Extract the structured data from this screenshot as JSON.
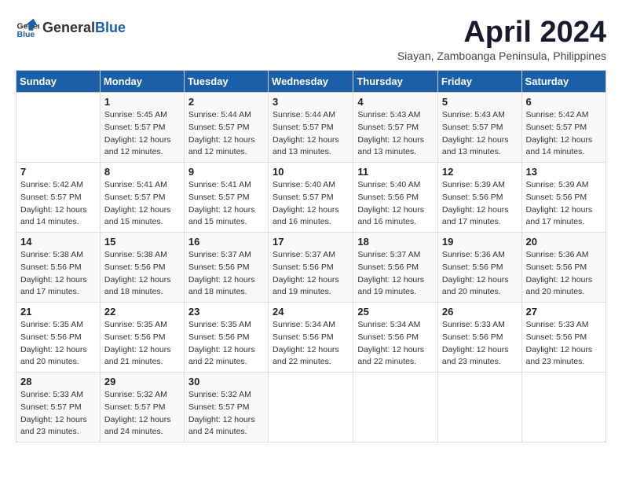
{
  "logo": {
    "text_general": "General",
    "text_blue": "Blue"
  },
  "title": "April 2024",
  "subtitle": "Siayan, Zamboanga Peninsula, Philippines",
  "headers": [
    "Sunday",
    "Monday",
    "Tuesday",
    "Wednesday",
    "Thursday",
    "Friday",
    "Saturday"
  ],
  "weeks": [
    [
      {
        "day": "",
        "sunrise": "",
        "sunset": "",
        "daylight": ""
      },
      {
        "day": "1",
        "sunrise": "Sunrise: 5:45 AM",
        "sunset": "Sunset: 5:57 PM",
        "daylight": "Daylight: 12 hours and 12 minutes."
      },
      {
        "day": "2",
        "sunrise": "Sunrise: 5:44 AM",
        "sunset": "Sunset: 5:57 PM",
        "daylight": "Daylight: 12 hours and 12 minutes."
      },
      {
        "day": "3",
        "sunrise": "Sunrise: 5:44 AM",
        "sunset": "Sunset: 5:57 PM",
        "daylight": "Daylight: 12 hours and 13 minutes."
      },
      {
        "day": "4",
        "sunrise": "Sunrise: 5:43 AM",
        "sunset": "Sunset: 5:57 PM",
        "daylight": "Daylight: 12 hours and 13 minutes."
      },
      {
        "day": "5",
        "sunrise": "Sunrise: 5:43 AM",
        "sunset": "Sunset: 5:57 PM",
        "daylight": "Daylight: 12 hours and 13 minutes."
      },
      {
        "day": "6",
        "sunrise": "Sunrise: 5:42 AM",
        "sunset": "Sunset: 5:57 PM",
        "daylight": "Daylight: 12 hours and 14 minutes."
      }
    ],
    [
      {
        "day": "7",
        "sunrise": "Sunrise: 5:42 AM",
        "sunset": "Sunset: 5:57 PM",
        "daylight": "Daylight: 12 hours and 14 minutes."
      },
      {
        "day": "8",
        "sunrise": "Sunrise: 5:41 AM",
        "sunset": "Sunset: 5:57 PM",
        "daylight": "Daylight: 12 hours and 15 minutes."
      },
      {
        "day": "9",
        "sunrise": "Sunrise: 5:41 AM",
        "sunset": "Sunset: 5:57 PM",
        "daylight": "Daylight: 12 hours and 15 minutes."
      },
      {
        "day": "10",
        "sunrise": "Sunrise: 5:40 AM",
        "sunset": "Sunset: 5:57 PM",
        "daylight": "Daylight: 12 hours and 16 minutes."
      },
      {
        "day": "11",
        "sunrise": "Sunrise: 5:40 AM",
        "sunset": "Sunset: 5:56 PM",
        "daylight": "Daylight: 12 hours and 16 minutes."
      },
      {
        "day": "12",
        "sunrise": "Sunrise: 5:39 AM",
        "sunset": "Sunset: 5:56 PM",
        "daylight": "Daylight: 12 hours and 17 minutes."
      },
      {
        "day": "13",
        "sunrise": "Sunrise: 5:39 AM",
        "sunset": "Sunset: 5:56 PM",
        "daylight": "Daylight: 12 hours and 17 minutes."
      }
    ],
    [
      {
        "day": "14",
        "sunrise": "Sunrise: 5:38 AM",
        "sunset": "Sunset: 5:56 PM",
        "daylight": "Daylight: 12 hours and 17 minutes."
      },
      {
        "day": "15",
        "sunrise": "Sunrise: 5:38 AM",
        "sunset": "Sunset: 5:56 PM",
        "daylight": "Daylight: 12 hours and 18 minutes."
      },
      {
        "day": "16",
        "sunrise": "Sunrise: 5:37 AM",
        "sunset": "Sunset: 5:56 PM",
        "daylight": "Daylight: 12 hours and 18 minutes."
      },
      {
        "day": "17",
        "sunrise": "Sunrise: 5:37 AM",
        "sunset": "Sunset: 5:56 PM",
        "daylight": "Daylight: 12 hours and 19 minutes."
      },
      {
        "day": "18",
        "sunrise": "Sunrise: 5:37 AM",
        "sunset": "Sunset: 5:56 PM",
        "daylight": "Daylight: 12 hours and 19 minutes."
      },
      {
        "day": "19",
        "sunrise": "Sunrise: 5:36 AM",
        "sunset": "Sunset: 5:56 PM",
        "daylight": "Daylight: 12 hours and 20 minutes."
      },
      {
        "day": "20",
        "sunrise": "Sunrise: 5:36 AM",
        "sunset": "Sunset: 5:56 PM",
        "daylight": "Daylight: 12 hours and 20 minutes."
      }
    ],
    [
      {
        "day": "21",
        "sunrise": "Sunrise: 5:35 AM",
        "sunset": "Sunset: 5:56 PM",
        "daylight": "Daylight: 12 hours and 20 minutes."
      },
      {
        "day": "22",
        "sunrise": "Sunrise: 5:35 AM",
        "sunset": "Sunset: 5:56 PM",
        "daylight": "Daylight: 12 hours and 21 minutes."
      },
      {
        "day": "23",
        "sunrise": "Sunrise: 5:35 AM",
        "sunset": "Sunset: 5:56 PM",
        "daylight": "Daylight: 12 hours and 22 minutes."
      },
      {
        "day": "24",
        "sunrise": "Sunrise: 5:34 AM",
        "sunset": "Sunset: 5:56 PM",
        "daylight": "Daylight: 12 hours and 22 minutes."
      },
      {
        "day": "25",
        "sunrise": "Sunrise: 5:34 AM",
        "sunset": "Sunset: 5:56 PM",
        "daylight": "Daylight: 12 hours and 22 minutes."
      },
      {
        "day": "26",
        "sunrise": "Sunrise: 5:33 AM",
        "sunset": "Sunset: 5:56 PM",
        "daylight": "Daylight: 12 hours and 23 minutes."
      },
      {
        "day": "27",
        "sunrise": "Sunrise: 5:33 AM",
        "sunset": "Sunset: 5:56 PM",
        "daylight": "Daylight: 12 hours and 23 minutes."
      }
    ],
    [
      {
        "day": "28",
        "sunrise": "Sunrise: 5:33 AM",
        "sunset": "Sunset: 5:57 PM",
        "daylight": "Daylight: 12 hours and 23 minutes."
      },
      {
        "day": "29",
        "sunrise": "Sunrise: 5:32 AM",
        "sunset": "Sunset: 5:57 PM",
        "daylight": "Daylight: 12 hours and 24 minutes."
      },
      {
        "day": "30",
        "sunrise": "Sunrise: 5:32 AM",
        "sunset": "Sunset: 5:57 PM",
        "daylight": "Daylight: 12 hours and 24 minutes."
      },
      {
        "day": "",
        "sunrise": "",
        "sunset": "",
        "daylight": ""
      },
      {
        "day": "",
        "sunrise": "",
        "sunset": "",
        "daylight": ""
      },
      {
        "day": "",
        "sunrise": "",
        "sunset": "",
        "daylight": ""
      },
      {
        "day": "",
        "sunrise": "",
        "sunset": "",
        "daylight": ""
      }
    ]
  ]
}
